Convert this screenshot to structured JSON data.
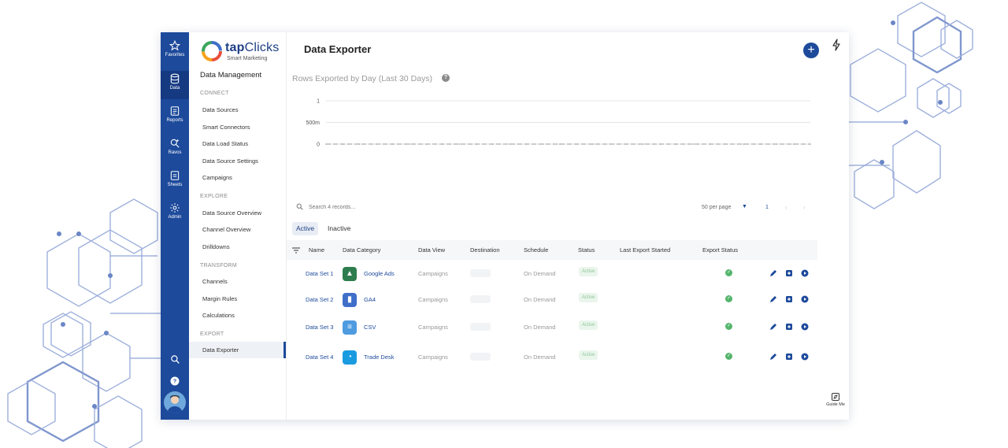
{
  "colors": {
    "brand": "#1d4a9b",
    "rail": "#1d4a9b",
    "success": "#55b56d",
    "link": "#1d4a9b",
    "decor": "#6a86c6"
  },
  "rail": {
    "items": [
      {
        "label": "Favorites",
        "icon": "star-icon"
      },
      {
        "label": "Data",
        "icon": "database-icon"
      },
      {
        "label": "Reports",
        "icon": "reports-icon"
      },
      {
        "label": "Ravos",
        "icon": "ravos-icon"
      },
      {
        "label": "Sheets",
        "icon": "sheets-icon"
      },
      {
        "label": "Admin",
        "icon": "gear-icon"
      }
    ],
    "bottom": {
      "search_icon": "search-icon",
      "help_icon": "help-icon",
      "avatar": "avatar"
    }
  },
  "brand": {
    "name_left": "tap",
    "name_right": "Clicks",
    "tagline": "Smart Marketing"
  },
  "sidebar": {
    "title": "Data Management",
    "sections": [
      {
        "heading": "CONNECT",
        "links": [
          "Data Sources",
          "Smart Connectors",
          "Data Load Status",
          "Data Source Settings",
          "Campaigns"
        ]
      },
      {
        "heading": "EXPLORE",
        "links": [
          "Data Source Overview",
          "Channel Overview",
          "Drilldowns"
        ]
      },
      {
        "heading": "TRANSFORM",
        "links": [
          "Channels",
          "Margin Rules",
          "Calculations"
        ]
      },
      {
        "heading": "EXPORT",
        "links": [
          "Data Exporter"
        ]
      }
    ],
    "active": "Data Exporter"
  },
  "main": {
    "title": "Data Exporter",
    "add_icon": "plus-icon",
    "bolt_icon": "bolt-icon",
    "chart_title": "Rows Exported by Day (Last 30 Days)",
    "search": {
      "placeholder": "Search 4 records..."
    },
    "pagination": {
      "per_page": "50 per page",
      "page": "1",
      "prev": "‹",
      "next": "›"
    },
    "tabs": [
      "Active",
      "Inactive"
    ],
    "columns": [
      "Name",
      "Data Category",
      "Data View",
      "Destination",
      "Schedule",
      "Status",
      "Last Export Started",
      "Export Status"
    ],
    "rows": [
      {
        "name": "Data Set 1",
        "category": "Google Ads",
        "category_icon": "google-ads-icon",
        "category_color": "#2e7d4f",
        "glyph": "▲",
        "view": "Campaigns",
        "schedule": "On Demand",
        "status": "Active"
      },
      {
        "name": "Data Set 2",
        "category": "GA4",
        "category_icon": "ga4-icon",
        "category_color": "#3f6fc9",
        "glyph": "▮",
        "view": "Campaigns",
        "schedule": "On Demand",
        "status": "Active"
      },
      {
        "name": "Data Set 3",
        "category": "CSV",
        "category_icon": "csv-icon",
        "category_color": "#4f9be0",
        "glyph": "≡",
        "view": "Campaigns",
        "schedule": "On Demand",
        "status": "Active"
      },
      {
        "name": "Data Set 4",
        "category": "Trade Desk",
        "category_icon": "trade-desk-icon",
        "category_color": "#1a9be0",
        "glyph": "◔",
        "view": "Campaigns",
        "schedule": "On Demand",
        "status": "Active"
      }
    ]
  },
  "guide": {
    "label": "Guide Me",
    "icon": "compass-icon"
  },
  "chart_data": {
    "type": "line",
    "title": "Rows Exported by Day (Last 30 Days)",
    "y_ticks": [
      "1",
      "500m",
      "0"
    ],
    "ylim": [
      0,
      1
    ],
    "series": [
      {
        "values": [
          0,
          0,
          0,
          0,
          0,
          0,
          0,
          0,
          0,
          0,
          0,
          0,
          0,
          0,
          0,
          0,
          0,
          0,
          0,
          0,
          0,
          0,
          0,
          0,
          0,
          0,
          0,
          0,
          0,
          0
        ]
      }
    ]
  }
}
